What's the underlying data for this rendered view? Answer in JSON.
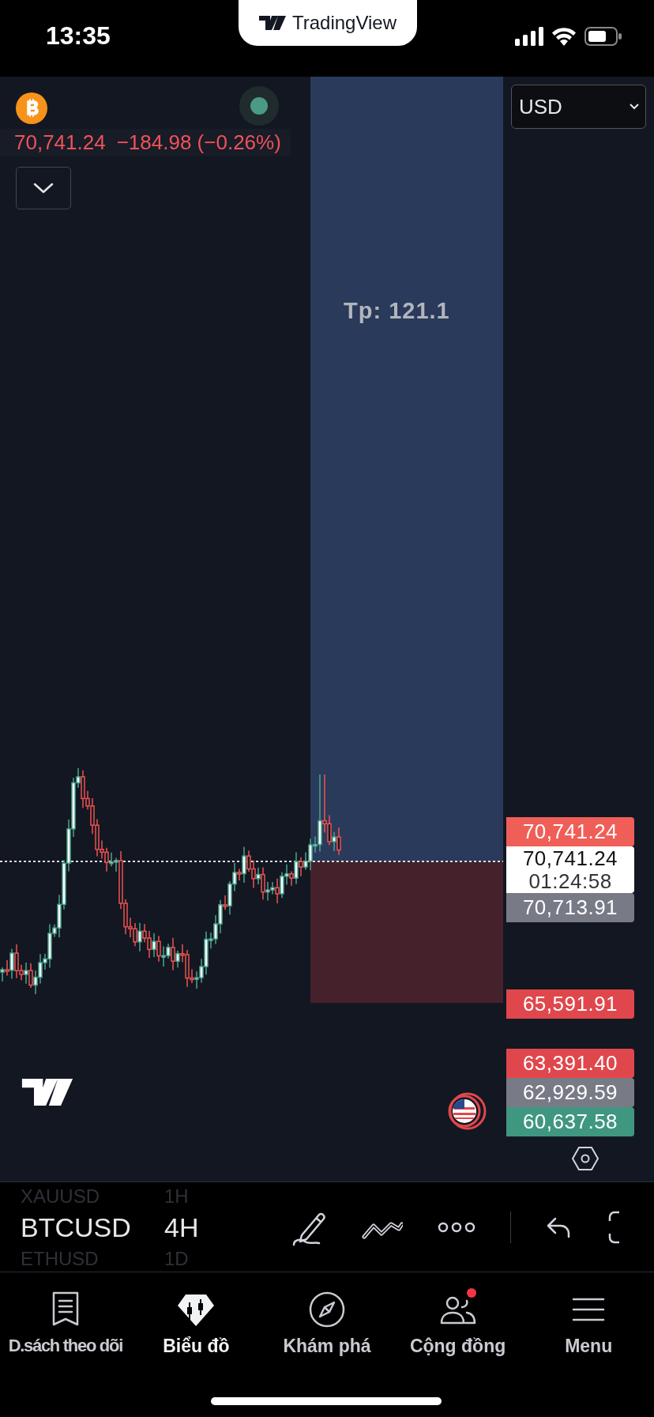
{
  "status_bar": {
    "time": "13:35",
    "banner": "TradingView"
  },
  "symbol": {
    "price": "70,741.24",
    "change": "−184.98 (−0.26%)",
    "market_open": true
  },
  "currency": {
    "value": "USD"
  },
  "position": {
    "label": "Tp: 121.1"
  },
  "price_labels": [
    {
      "kind": "plain",
      "value": "70,741.24",
      "color": "#ef5f57"
    },
    {
      "kind": "current",
      "value": "70,741.24",
      "countdown": "01:24:58",
      "color": "#ffffff"
    },
    {
      "kind": "plain",
      "value": "70,713.91",
      "color": "#787b86"
    },
    {
      "kind": "plain",
      "value": "65,591.91",
      "color": "#e0474c"
    },
    {
      "kind": "plain",
      "value": "63,391.40",
      "color": "#e0474c"
    },
    {
      "kind": "plain",
      "value": "62,929.59",
      "color": "#787b86"
    },
    {
      "kind": "plain",
      "value": "60,637.58",
      "color": "#409781"
    }
  ],
  "symbols": [
    {
      "label": "XAUUSD",
      "selected": false
    },
    {
      "label": "BTCUSD",
      "selected": true
    },
    {
      "label": "ETHUSD",
      "selected": false
    }
  ],
  "intervals": [
    {
      "label": "1H",
      "selected": false
    },
    {
      "label": "4H",
      "selected": true
    },
    {
      "label": "1D",
      "selected": false
    }
  ],
  "tabs": [
    {
      "label": "D.sách theo dõi",
      "selected": false,
      "badge": false
    },
    {
      "label": "Biểu đồ",
      "selected": true,
      "badge": false
    },
    {
      "label": "Khám phá",
      "selected": false,
      "badge": false
    },
    {
      "label": "Cộng đồng",
      "selected": false,
      "badge": true
    },
    {
      "label": "Menu",
      "selected": false,
      "badge": false
    }
  ]
}
